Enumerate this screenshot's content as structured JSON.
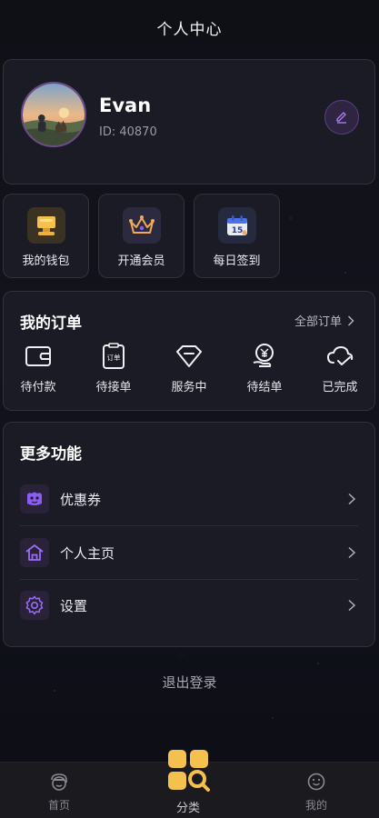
{
  "header": {
    "title": "个人中心"
  },
  "profile": {
    "name": "Evan",
    "id": "ID: 40870"
  },
  "quick_actions": [
    {
      "label": "我的钱包",
      "icon": "wallet-icon"
    },
    {
      "label": "开通会员",
      "icon": "crown-icon"
    },
    {
      "label": "每日签到",
      "icon": "calendar-icon",
      "badge": "15"
    }
  ],
  "orders": {
    "title": "我的订单",
    "all_label": "全部订单",
    "items": [
      {
        "label": "待付款",
        "icon": "wallet-outline-icon"
      },
      {
        "label": "待接单",
        "icon": "clipboard-order-icon",
        "icon_text": "订单"
      },
      {
        "label": "服务中",
        "icon": "diamond-icon"
      },
      {
        "label": "待结单",
        "icon": "yen-hand-icon"
      },
      {
        "label": "已完成",
        "icon": "cloud-check-icon"
      }
    ]
  },
  "more": {
    "title": "更多功能",
    "items": [
      {
        "label": "优惠券",
        "icon": "coupon-icon"
      },
      {
        "label": "个人主页",
        "icon": "home-icon"
      },
      {
        "label": "设置",
        "icon": "gear-icon"
      }
    ]
  },
  "logout_label": "退出登录",
  "tabbar": {
    "items": [
      {
        "label": "首页",
        "icon": "home-face-icon"
      },
      {
        "label": "分类",
        "icon": "category-search-icon",
        "active": true
      },
      {
        "label": "我的",
        "icon": "smile-icon"
      }
    ]
  },
  "colors": {
    "accent": "#8b5cf6",
    "gold": "#f4c04e",
    "background": "#101118",
    "card": "#1c1d26"
  }
}
